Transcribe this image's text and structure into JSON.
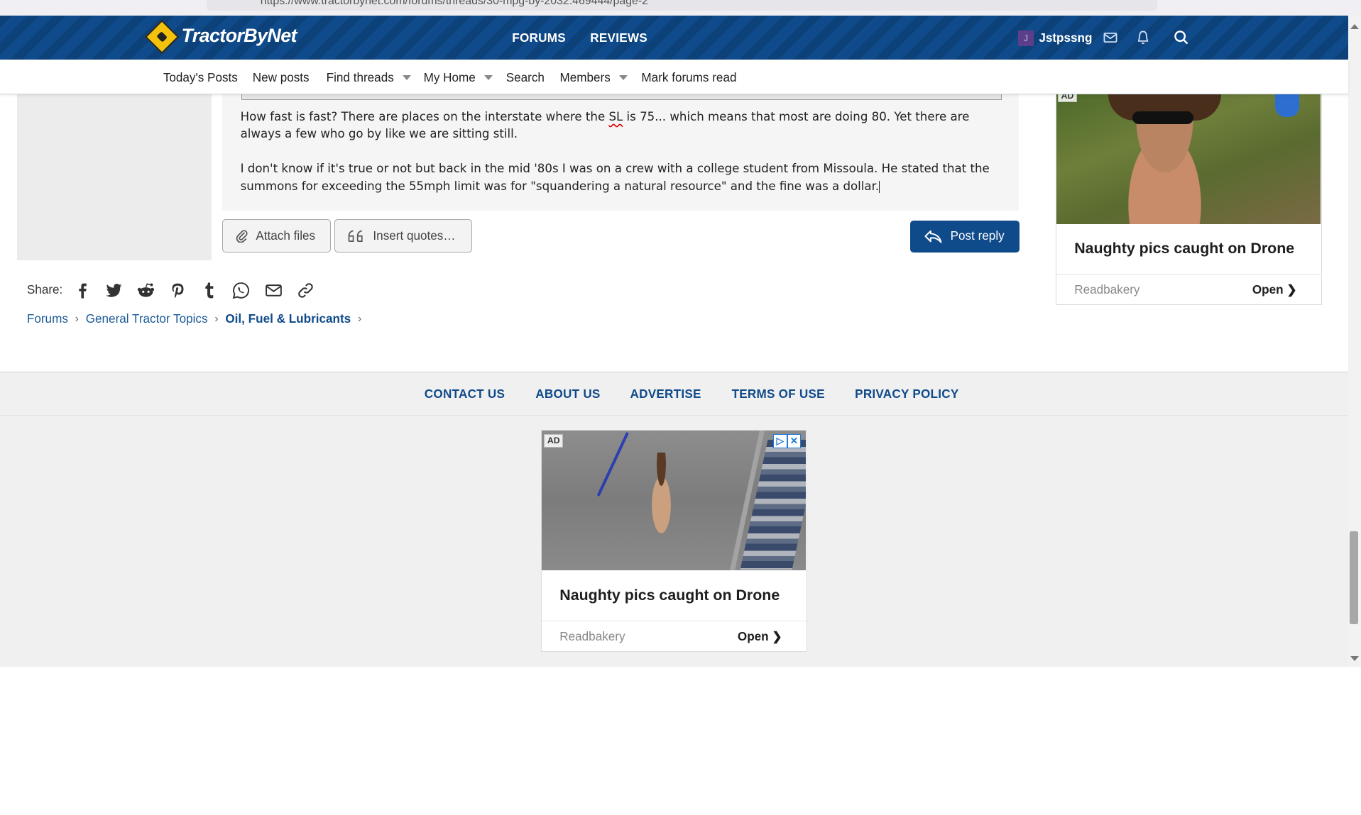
{
  "browser": {
    "url": "https://www.tractorbynet.com/forums/threads/30-mpg-by-2032.469444/page-2"
  },
  "header": {
    "logo_text": "TractorByNet",
    "nav": [
      "FORUMS",
      "REVIEWS"
    ],
    "user": {
      "initial": "J",
      "name": "Jstpssng"
    },
    "brand_color": "#0f4a8a"
  },
  "subnav": {
    "items": [
      {
        "label": "Today's Posts",
        "dropdown": false
      },
      {
        "label": "New posts",
        "dropdown": false
      },
      {
        "label": "Find threads",
        "dropdown": true
      },
      {
        "label": "My Home",
        "dropdown": true
      },
      {
        "label": "Search",
        "dropdown": false
      },
      {
        "label": "Members",
        "dropdown": true
      },
      {
        "label": "Mark forums read",
        "dropdown": false
      }
    ]
  },
  "editor": {
    "para1_before": "How fast is fast? There are places on the interstate where the ",
    "para1_flagged": "SL",
    "para1_after": " is 75... which means that most are doing 80. Yet there are always a few who go by like we are sitting still.",
    "para2": "I don't know if it's true or not but back in the mid '80s I was on a crew with a college student from Missoula. He stated that the summons for exceeding the 55mph limit was for \"squandering a natural resource\" and the fine was a dollar."
  },
  "actions": {
    "attach_label": "Attach files",
    "quotes_label": "Insert quotes…",
    "post_reply_label": "Post reply"
  },
  "share": {
    "label": "Share:",
    "icons": [
      "facebook-icon",
      "twitter-icon",
      "reddit-icon",
      "pinterest-icon",
      "tumblr-icon",
      "whatsapp-icon",
      "email-icon",
      "link-icon"
    ]
  },
  "breadcrumb": [
    "Forums",
    "General Tractor Topics",
    "Oil, Fuel & Lubricants"
  ],
  "ad_right": {
    "badge": "AD",
    "title": "Naughty pics caught on Drone",
    "source": "Readbakery",
    "open": "Open"
  },
  "footer": {
    "links": [
      "CONTACT US",
      "ABOUT US",
      "ADVERTISE",
      "TERMS OF USE",
      "PRIVACY POLICY"
    ]
  },
  "ad_bottom": {
    "badge": "AD",
    "title": "Naughty pics caught on Drone",
    "source": "Readbakery",
    "open": "Open"
  }
}
